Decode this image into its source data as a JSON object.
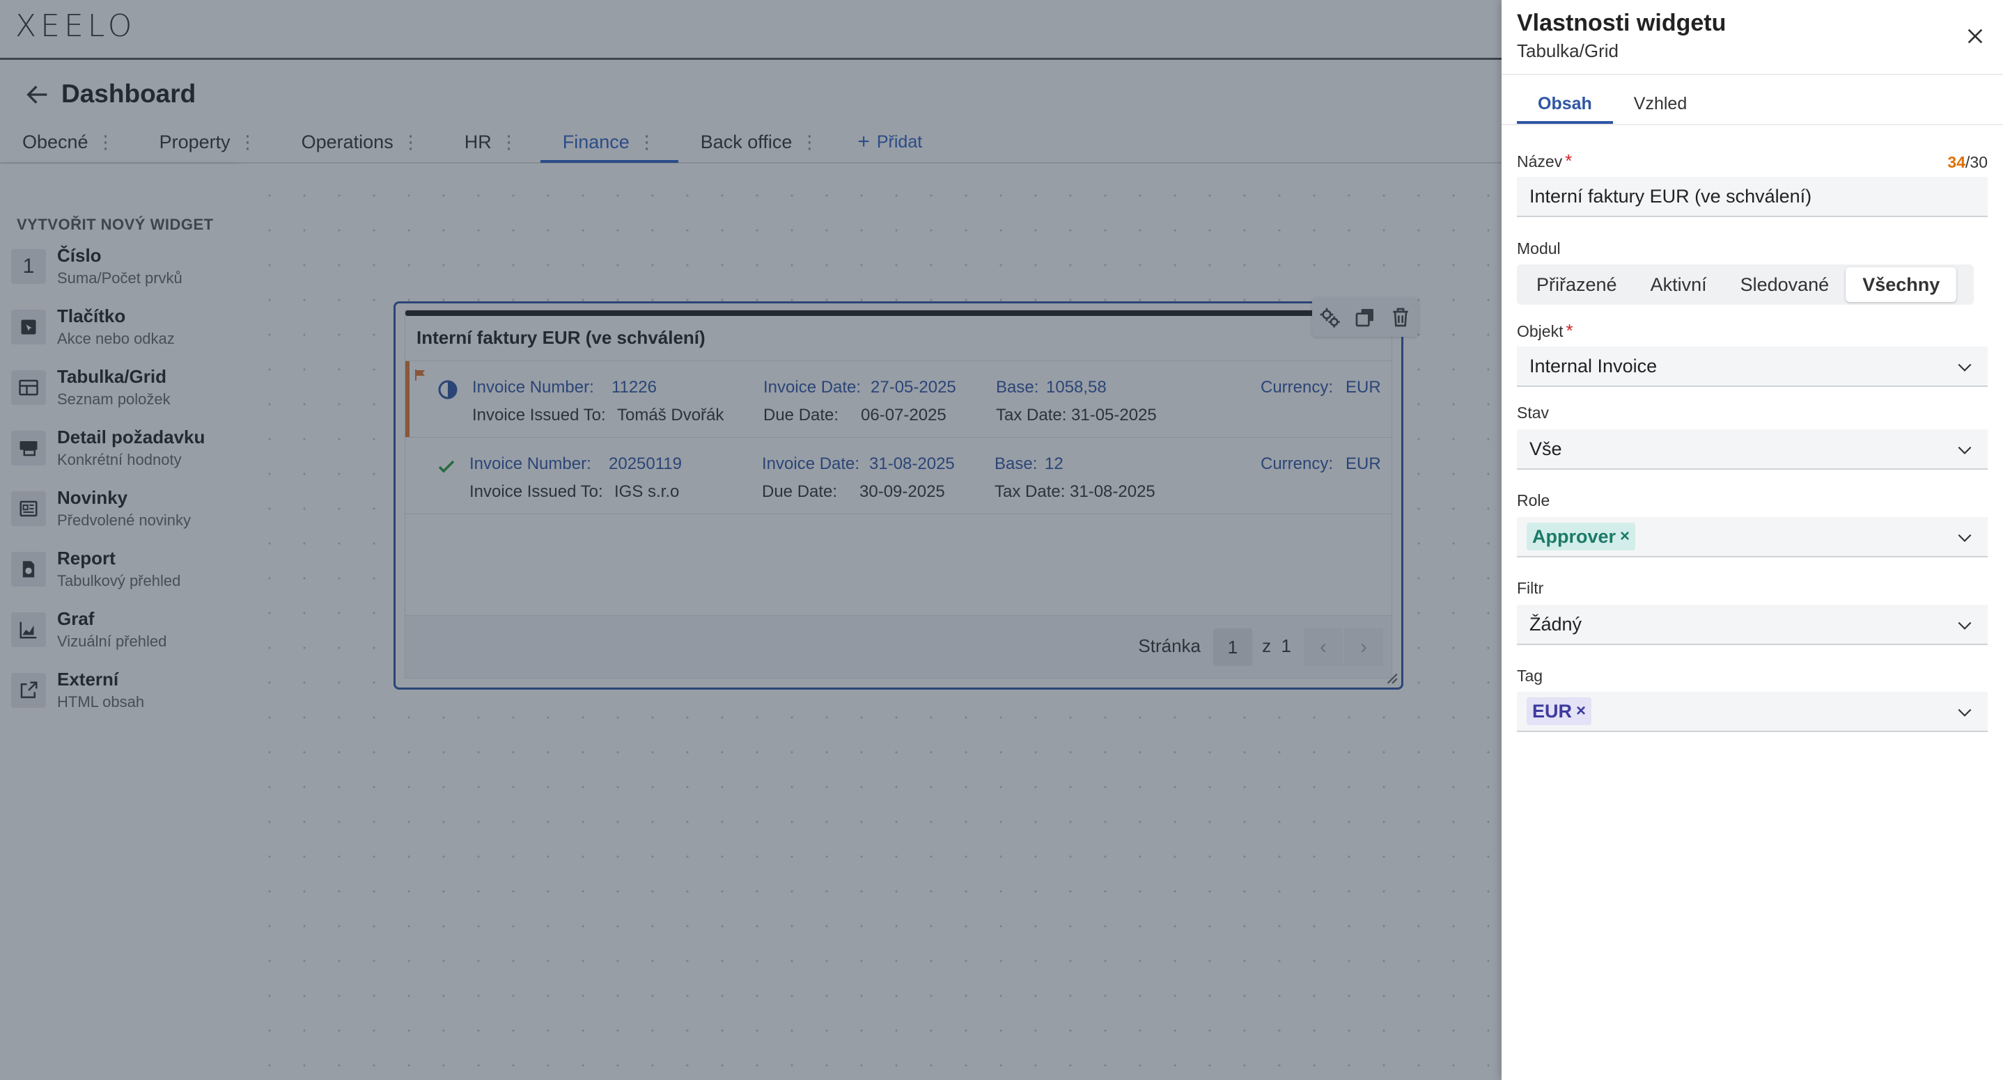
{
  "app": {
    "logo": "XEELO",
    "page_title": "Dashboard",
    "tabs": [
      {
        "label": "Obecné"
      },
      {
        "label": "Property"
      },
      {
        "label": "Operations"
      },
      {
        "label": "HR"
      },
      {
        "label": "Finance",
        "active": true
      },
      {
        "label": "Back office"
      }
    ],
    "add_tab_label": "Přidat"
  },
  "sidebar": {
    "heading": "VYTVOŘIT NOVÝ WIDGET",
    "items": [
      {
        "icon": "number-icon",
        "icon_glyph": "1",
        "title": "Číslo",
        "subtitle": "Suma/Počet prvků"
      },
      {
        "icon": "button-icon",
        "title": "Tlačítko",
        "subtitle": "Akce nebo odkaz"
      },
      {
        "icon": "table-icon",
        "title": "Tabulka/Grid",
        "subtitle": "Seznam položek"
      },
      {
        "icon": "detail-icon",
        "title": "Detail požadavku",
        "subtitle": "Konkrétní hodnoty"
      },
      {
        "icon": "news-icon",
        "title": "Novinky",
        "subtitle": "Předvolené novinky"
      },
      {
        "icon": "report-icon",
        "title": "Report",
        "subtitle": "Tabulkový přehled"
      },
      {
        "icon": "chart-icon",
        "title": "Graf",
        "subtitle": "Vizuální přehled"
      },
      {
        "icon": "external-link-icon",
        "title": "Externí",
        "subtitle": "HTML obsah"
      }
    ]
  },
  "widget": {
    "title": "Interní faktury EUR (ve schválení)",
    "rows": [
      {
        "status": "half-circle-icon",
        "flagged": true,
        "invoice_number_label": "Invoice Number:",
        "invoice_number": "11226",
        "invoice_date_label": "Invoice Date:",
        "invoice_date": "27-05-2025",
        "base_label": "Base:",
        "base": "1058,58",
        "currency_label": "Currency:",
        "currency": "EUR",
        "issued_to_label": "Invoice Issued To:",
        "issued_to": "Tomáš Dvořák",
        "due_date_label": "Due Date:",
        "due_date": "06-07-2025",
        "tax_date_label": "Tax Date:",
        "tax_date": "31-05-2025"
      },
      {
        "status": "check-icon",
        "flagged": false,
        "invoice_number_label": "Invoice Number:",
        "invoice_number": "20250119",
        "invoice_date_label": "Invoice Date:",
        "invoice_date": "31-08-2025",
        "base_label": "Base:",
        "base": "12",
        "currency_label": "Currency:",
        "currency": "EUR",
        "issued_to_label": "Invoice Issued To:",
        "issued_to": "IGS s.r.o",
        "due_date_label": "Due Date:",
        "due_date": "30-09-2025",
        "tax_date_label": "Tax Date:",
        "tax_date": "31-08-2025"
      }
    ],
    "pager": {
      "label": "Stránka",
      "page": "1",
      "of_label": "z",
      "total": "1"
    }
  },
  "panel": {
    "title": "Vlastnosti widgetu",
    "subtitle": "Tabulka/Grid",
    "tabs": [
      {
        "label": "Obsah",
        "active": true
      },
      {
        "label": "Vzhled"
      }
    ],
    "name": {
      "label": "Název",
      "value": "Interní faktury EUR (ve schválení)",
      "count": "34",
      "max": "/30"
    },
    "modul": {
      "label": "Modul",
      "options": [
        "Přiřazené",
        "Aktivní",
        "Sledované",
        "Všechny"
      ],
      "selected": "Všechny"
    },
    "objekt": {
      "label": "Objekt",
      "value": "Internal Invoice"
    },
    "stav": {
      "label": "Stav",
      "value": "Vše"
    },
    "role": {
      "label": "Role",
      "chip": "Approver"
    },
    "filtr": {
      "label": "Filtr",
      "value": "Žádný"
    },
    "tag": {
      "label": "Tag",
      "chip": "EUR"
    }
  },
  "colors": {
    "accent": "#2f55a4",
    "overlay": "#283446",
    "warning": "#e07000",
    "flag": "#e07a2e",
    "success": "#2a9a3a"
  }
}
